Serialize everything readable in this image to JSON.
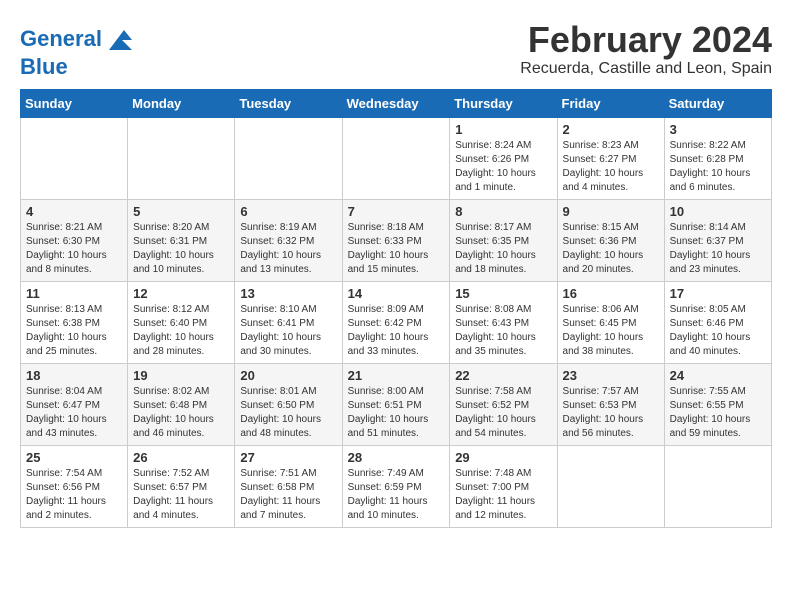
{
  "logo": {
    "line1": "General",
    "line2": "Blue"
  },
  "title": "February 2024",
  "subtitle": "Recuerda, Castille and Leon, Spain",
  "days_header": [
    "Sunday",
    "Monday",
    "Tuesday",
    "Wednesday",
    "Thursday",
    "Friday",
    "Saturday"
  ],
  "weeks": [
    [
      {
        "day": "",
        "info": ""
      },
      {
        "day": "",
        "info": ""
      },
      {
        "day": "",
        "info": ""
      },
      {
        "day": "",
        "info": ""
      },
      {
        "day": "1",
        "info": "Sunrise: 8:24 AM\nSunset: 6:26 PM\nDaylight: 10 hours and 1 minute."
      },
      {
        "day": "2",
        "info": "Sunrise: 8:23 AM\nSunset: 6:27 PM\nDaylight: 10 hours and 4 minutes."
      },
      {
        "day": "3",
        "info": "Sunrise: 8:22 AM\nSunset: 6:28 PM\nDaylight: 10 hours and 6 minutes."
      }
    ],
    [
      {
        "day": "4",
        "info": "Sunrise: 8:21 AM\nSunset: 6:30 PM\nDaylight: 10 hours and 8 minutes."
      },
      {
        "day": "5",
        "info": "Sunrise: 8:20 AM\nSunset: 6:31 PM\nDaylight: 10 hours and 10 minutes."
      },
      {
        "day": "6",
        "info": "Sunrise: 8:19 AM\nSunset: 6:32 PM\nDaylight: 10 hours and 13 minutes."
      },
      {
        "day": "7",
        "info": "Sunrise: 8:18 AM\nSunset: 6:33 PM\nDaylight: 10 hours and 15 minutes."
      },
      {
        "day": "8",
        "info": "Sunrise: 8:17 AM\nSunset: 6:35 PM\nDaylight: 10 hours and 18 minutes."
      },
      {
        "day": "9",
        "info": "Sunrise: 8:15 AM\nSunset: 6:36 PM\nDaylight: 10 hours and 20 minutes."
      },
      {
        "day": "10",
        "info": "Sunrise: 8:14 AM\nSunset: 6:37 PM\nDaylight: 10 hours and 23 minutes."
      }
    ],
    [
      {
        "day": "11",
        "info": "Sunrise: 8:13 AM\nSunset: 6:38 PM\nDaylight: 10 hours and 25 minutes."
      },
      {
        "day": "12",
        "info": "Sunrise: 8:12 AM\nSunset: 6:40 PM\nDaylight: 10 hours and 28 minutes."
      },
      {
        "day": "13",
        "info": "Sunrise: 8:10 AM\nSunset: 6:41 PM\nDaylight: 10 hours and 30 minutes."
      },
      {
        "day": "14",
        "info": "Sunrise: 8:09 AM\nSunset: 6:42 PM\nDaylight: 10 hours and 33 minutes."
      },
      {
        "day": "15",
        "info": "Sunrise: 8:08 AM\nSunset: 6:43 PM\nDaylight: 10 hours and 35 minutes."
      },
      {
        "day": "16",
        "info": "Sunrise: 8:06 AM\nSunset: 6:45 PM\nDaylight: 10 hours and 38 minutes."
      },
      {
        "day": "17",
        "info": "Sunrise: 8:05 AM\nSunset: 6:46 PM\nDaylight: 10 hours and 40 minutes."
      }
    ],
    [
      {
        "day": "18",
        "info": "Sunrise: 8:04 AM\nSunset: 6:47 PM\nDaylight: 10 hours and 43 minutes."
      },
      {
        "day": "19",
        "info": "Sunrise: 8:02 AM\nSunset: 6:48 PM\nDaylight: 10 hours and 46 minutes."
      },
      {
        "day": "20",
        "info": "Sunrise: 8:01 AM\nSunset: 6:50 PM\nDaylight: 10 hours and 48 minutes."
      },
      {
        "day": "21",
        "info": "Sunrise: 8:00 AM\nSunset: 6:51 PM\nDaylight: 10 hours and 51 minutes."
      },
      {
        "day": "22",
        "info": "Sunrise: 7:58 AM\nSunset: 6:52 PM\nDaylight: 10 hours and 54 minutes."
      },
      {
        "day": "23",
        "info": "Sunrise: 7:57 AM\nSunset: 6:53 PM\nDaylight: 10 hours and 56 minutes."
      },
      {
        "day": "24",
        "info": "Sunrise: 7:55 AM\nSunset: 6:55 PM\nDaylight: 10 hours and 59 minutes."
      }
    ],
    [
      {
        "day": "25",
        "info": "Sunrise: 7:54 AM\nSunset: 6:56 PM\nDaylight: 11 hours and 2 minutes."
      },
      {
        "day": "26",
        "info": "Sunrise: 7:52 AM\nSunset: 6:57 PM\nDaylight: 11 hours and 4 minutes."
      },
      {
        "day": "27",
        "info": "Sunrise: 7:51 AM\nSunset: 6:58 PM\nDaylight: 11 hours and 7 minutes."
      },
      {
        "day": "28",
        "info": "Sunrise: 7:49 AM\nSunset: 6:59 PM\nDaylight: 11 hours and 10 minutes."
      },
      {
        "day": "29",
        "info": "Sunrise: 7:48 AM\nSunset: 7:00 PM\nDaylight: 11 hours and 12 minutes."
      },
      {
        "day": "",
        "info": ""
      },
      {
        "day": "",
        "info": ""
      }
    ]
  ]
}
